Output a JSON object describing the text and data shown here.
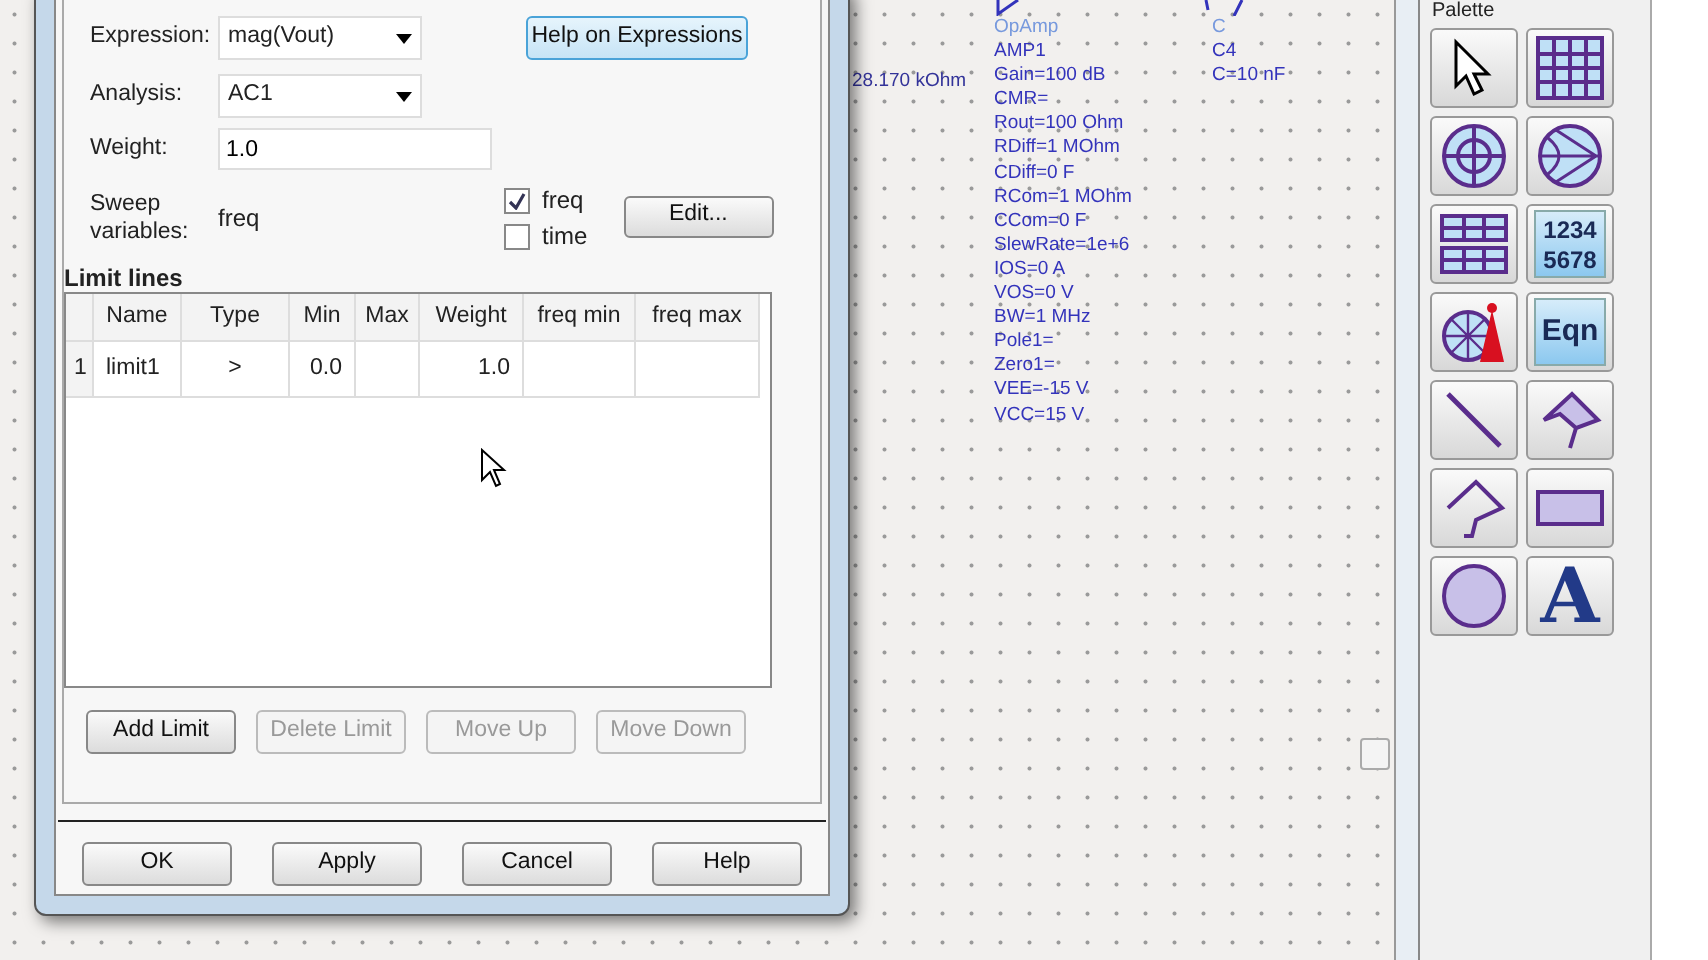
{
  "dialog": {
    "expression": {
      "label": "Expression:",
      "value": "mag(Vout)"
    },
    "help_button": "Help on Expressions",
    "analysis": {
      "label": "Analysis:",
      "value": "AC1"
    },
    "weight": {
      "label": "Weight:",
      "value": "1.0"
    },
    "sweep": {
      "label": "Sweep variables:",
      "value": "freq"
    },
    "checkboxes": [
      {
        "label": "freq",
        "checked": true
      },
      {
        "label": "time",
        "checked": false
      }
    ],
    "edit_button": "Edit...",
    "limit_lines": {
      "title": "Limit lines",
      "columns": [
        "Name",
        "Type",
        "Min",
        "Max",
        "Weight",
        "freq min",
        "freq max"
      ],
      "rows": [
        {
          "index": "1",
          "cells": [
            "limit1",
            ">",
            "0.0",
            "",
            "1.0",
            "",
            ""
          ]
        }
      ]
    },
    "limit_buttons": [
      {
        "label": "Add Limit",
        "disabled": false
      },
      {
        "label": "Delete Limit",
        "disabled": true
      },
      {
        "label": "Move Up",
        "disabled": true
      },
      {
        "label": "Move Down",
        "disabled": true
      }
    ],
    "buttons": [
      "OK",
      "Apply",
      "Cancel",
      "Help"
    ]
  },
  "schematic": {
    "resistor_value": "28.170 kOhm",
    "components": [
      {
        "type": "OpAmp",
        "name": "AMP1",
        "params": [
          "Gain=100 dB",
          "CMR=",
          "Rout=100 Ohm",
          "RDiff=1 MOhm",
          "CDiff=0 F",
          "RCom=1 MOhm",
          "CCom=0 F",
          "SlewRate=1e+6",
          "IOS=0 A",
          "VOS=0 V",
          "BW=1 MHz",
          "Pole1=",
          "Zero1=",
          "VEE=-15 V",
          "VCC=15 V"
        ]
      },
      {
        "type": "C",
        "name": "C4",
        "params": [
          "C=10 nF"
        ]
      }
    ]
  },
  "palette": {
    "title": "Palette",
    "items": [
      {
        "kind": "pointer"
      },
      {
        "kind": "grid"
      },
      {
        "kind": "crosshair"
      },
      {
        "kind": "smith"
      },
      {
        "kind": "table"
      },
      {
        "kind": "numbers",
        "label": "1234",
        "label2": "5678"
      },
      {
        "kind": "antenna"
      },
      {
        "kind": "text",
        "label": "Eqn"
      },
      {
        "kind": "line"
      },
      {
        "kind": "polygon"
      },
      {
        "kind": "polyline"
      },
      {
        "kind": "rectangle"
      },
      {
        "kind": "circle"
      },
      {
        "kind": "letter",
        "label": "A"
      }
    ]
  }
}
